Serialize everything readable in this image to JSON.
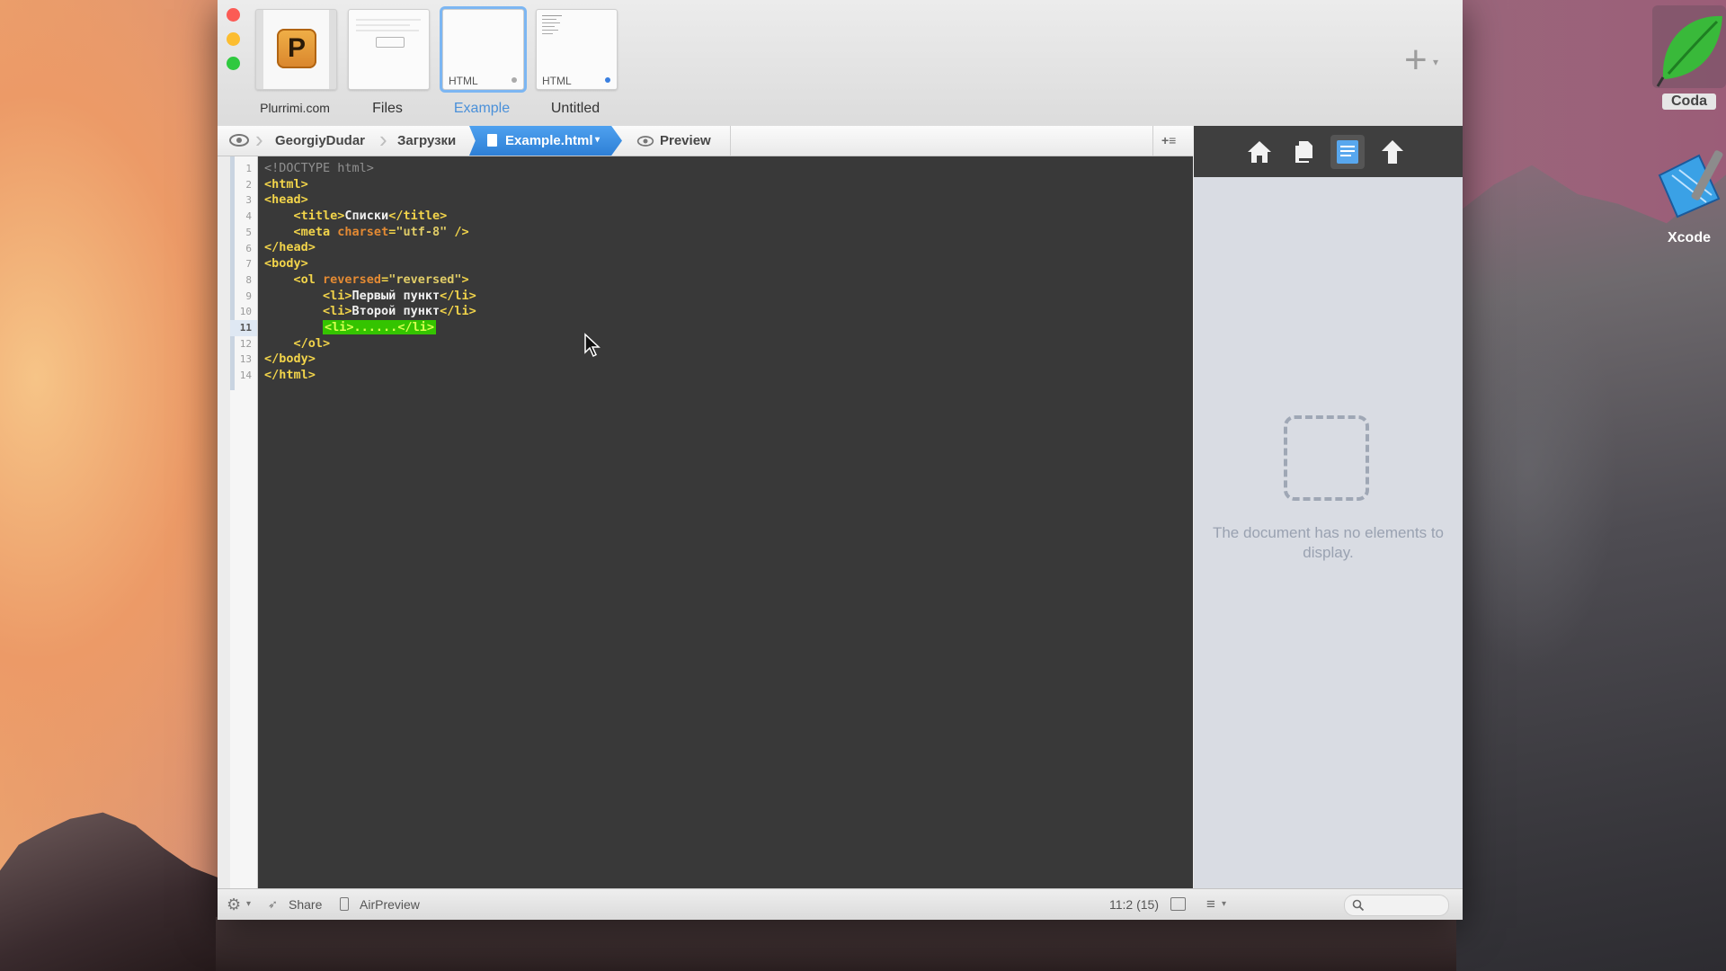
{
  "window": {
    "sites": [
      {
        "label": "Plurrimi.com"
      },
      {
        "label": "Files"
      },
      {
        "label": "Example",
        "badge": "HTML"
      },
      {
        "label": "Untitled",
        "badge": "HTML"
      }
    ],
    "add_icon": "plus-icon"
  },
  "pathbar": {
    "items": [
      "GeorgiyDudar",
      "Загрузки",
      "Example.html",
      "Preview"
    ],
    "active_index": 2
  },
  "editor": {
    "line_numbers": [
      "1",
      "2",
      "3",
      "4",
      "5",
      "6",
      "7",
      "8",
      "9",
      "10",
      "11",
      "12",
      "13",
      "14"
    ],
    "current_line": "11",
    "lines": [
      "<!DOCTYPE html>",
      "<html>",
      "<head>",
      "    <title>Списки</title>",
      "    <meta charset=\"utf-8\" />",
      "</head>",
      "<body>",
      "    <ol reversed=\"reversed\">",
      "        <li>Первый пункт</li>",
      "        <li>Второй пункт</li>",
      "        <li>......</li>",
      "    </ol>",
      "</body>",
      "</html>"
    ],
    "token_text": {
      "title_text": "Списки",
      "charset_attr": "charset",
      "charset_val": "\"utf-8\"",
      "reversed_attr": "reversed",
      "reversed_val": "\"reversed\"",
      "li1_text": "Первый пункт",
      "li2_text": "Второй пункт",
      "li3_text": "......"
    }
  },
  "sidebar": {
    "icons": [
      "home-icon",
      "files-icon",
      "list-icon",
      "upload-icon"
    ],
    "empty_message": "The document has no elements to display."
  },
  "statusbar": {
    "share_label": "Share",
    "airpreview_label": "AirPreview",
    "cursor_position": "11:2 (15)"
  },
  "desktop_apps": [
    {
      "label": "Coda",
      "icon": "coda-leaf-icon"
    },
    {
      "label": "Xcode",
      "icon": "xcode-hammer-icon"
    }
  ],
  "colors": {
    "accent": "#2e7fd6",
    "editor_bg": "#393939",
    "tag": "#f2d44a",
    "attribute": "#e48a33",
    "highlight": "#34c400"
  }
}
